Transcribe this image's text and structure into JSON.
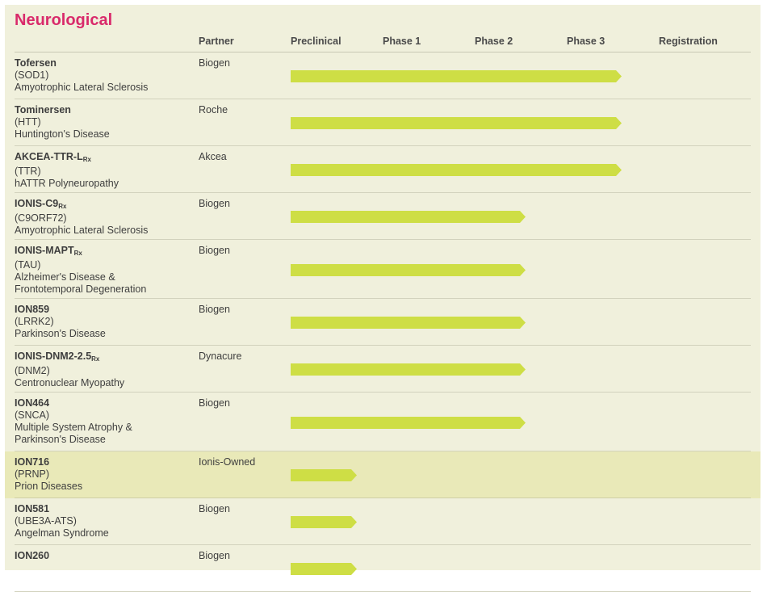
{
  "section_title": "Neurological",
  "headers": {
    "partner": "Partner",
    "phases": [
      "Preclinical",
      "Phase 1",
      "Phase 2",
      "Phase 3",
      "Registration"
    ]
  },
  "colors": {
    "title": "#d92a6b",
    "bar": "#cede45",
    "highlight_row": "#e9e9b8"
  },
  "chart_data": {
    "type": "bar",
    "stages": [
      "Preclinical",
      "Phase 1",
      "Phase 2",
      "Phase 3",
      "Registration"
    ],
    "rows": [
      {
        "name": "Tofersen",
        "sub": "",
        "target": "(SOD1)",
        "indication": [
          "Amyotrophic Lateral Sclerosis"
        ],
        "partner": "Biogen",
        "progress": 3.6,
        "highlight": false
      },
      {
        "name": "Tominersen",
        "sub": "",
        "target": "(HTT)",
        "indication": [
          "Huntington's Disease"
        ],
        "partner": "Roche",
        "progress": 3.6,
        "highlight": false
      },
      {
        "name": "AKCEA-TTR-L",
        "sub": "Rx",
        "target": "(TTR)",
        "indication": [
          "hATTR Polyneuropathy"
        ],
        "partner": "Akcea",
        "progress": 3.6,
        "highlight": false
      },
      {
        "name": "IONIS-C9",
        "sub": "Rx",
        "target": "(C9ORF72)",
        "indication": [
          "Amyotrophic Lateral Sclerosis"
        ],
        "partner": "Biogen",
        "progress": 2.55,
        "highlight": false
      },
      {
        "name": "IONIS-MAPT",
        "sub": "Rx",
        "target": "(TAU)",
        "indication": [
          "Alzheimer's Disease &",
          "Frontotemporal Degeneration"
        ],
        "partner": "Biogen",
        "progress": 2.55,
        "highlight": false
      },
      {
        "name": "ION859",
        "sub": "",
        "target": "(LRRK2)",
        "indication": [
          "Parkinson's Disease"
        ],
        "partner": "Biogen",
        "progress": 2.55,
        "highlight": false
      },
      {
        "name": "IONIS-DNM2-2.5",
        "sub": "Rx",
        "target": "(DNM2)",
        "indication": [
          "Centronuclear Myopathy"
        ],
        "partner": "Dynacure",
        "progress": 2.55,
        "highlight": false
      },
      {
        "name": "ION464",
        "sub": "",
        "target": "(SNCA)",
        "indication": [
          "Multiple System Atrophy &",
          "Parkinson's Disease"
        ],
        "partner": "Biogen",
        "progress": 2.55,
        "highlight": false
      },
      {
        "name": "ION716",
        "sub": "",
        "target": "(PRNP)",
        "indication": [
          "Prion Diseases"
        ],
        "partner": "Ionis-Owned",
        "progress": 0.72,
        "highlight": true
      },
      {
        "name": "ION581",
        "sub": "",
        "target": "(UBE3A-ATS)",
        "indication": [
          "Angelman Syndrome"
        ],
        "partner": "Biogen",
        "progress": 0.72,
        "highlight": false
      },
      {
        "name": "ION260",
        "sub": "",
        "target": "",
        "indication": [],
        "partner": "Biogen",
        "progress": 0.72,
        "highlight": false
      }
    ]
  }
}
